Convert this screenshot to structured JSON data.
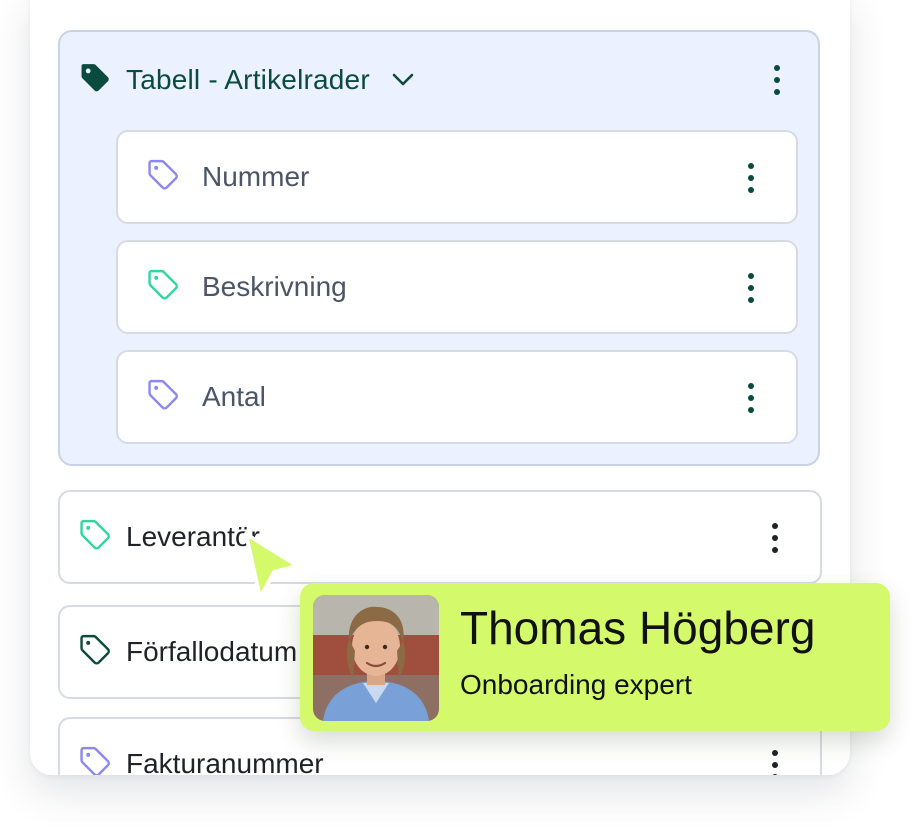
{
  "group": {
    "title": "Tabell - Artikelrader",
    "icon": "tag-filled-icon",
    "children": [
      {
        "label": "Nummer",
        "tag_color": "#8b88ef"
      },
      {
        "label": "Beskrivning",
        "tag_color": "#2fd7a0"
      },
      {
        "label": "Antal",
        "tag_color": "#8b88ef"
      }
    ]
  },
  "fields": [
    {
      "label": "Leverantör",
      "tag_color": "#2fd7a0"
    },
    {
      "label": "Förfallodatum",
      "tag_color": "#0b4a3e"
    },
    {
      "label": "Fakturanummer",
      "tag_color": "#8b88ef"
    }
  ],
  "tooltip": {
    "name": "Thomas Högberg",
    "role": "Onboarding expert",
    "background": "#d4fa6b"
  },
  "colors": {
    "accent": "#0b4a3e",
    "group_background": "#ebf1fe",
    "cursor": "#d4fa6b"
  }
}
